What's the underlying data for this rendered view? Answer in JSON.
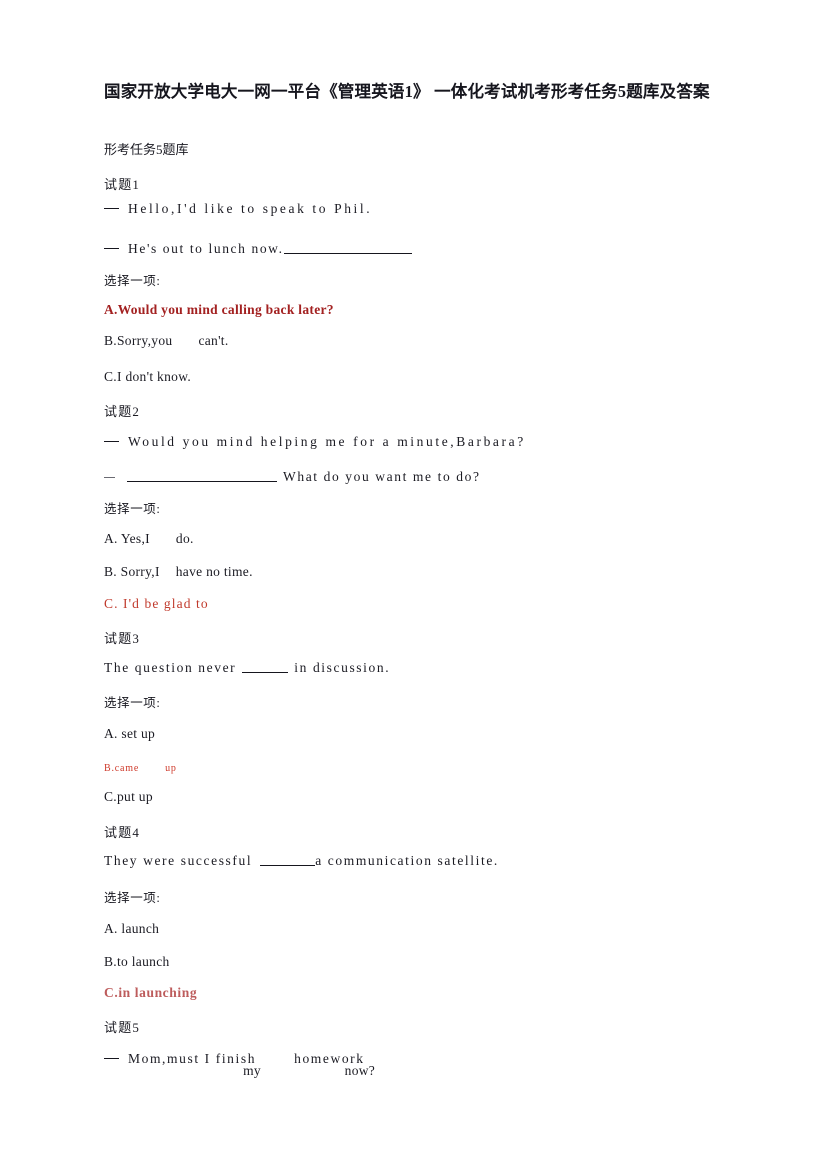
{
  "document": {
    "title": "国家开放大学电大一网一平台《管理英语1》 一体化考试机考形考任务5题库及答案",
    "section_label": "形考任务5题库",
    "choose_one_label": "选择一项:",
    "colors": {
      "text": "#1a1a22",
      "answer_crimson": "#a32121",
      "answer_red": "#c0392b",
      "answer_red_small": "#cf3b2c",
      "answer_rose": "#bd5c5c"
    }
  },
  "questions": [
    {
      "heading": "试题1",
      "prompt_lines": [
        "Hello,I'd  like  to  speak  to  Phil.",
        "He's  out  to  lunch  now."
      ],
      "choose_label": "选择一项:",
      "options": [
        {
          "label": "A.Would you mind calling back later?",
          "is_answer": true,
          "style": "bold-crimson"
        },
        {
          "label": "B.Sorry,you",
          "label_tail": "can't.",
          "is_answer": false,
          "style": "normal"
        },
        {
          "label": "C.I  don't  know.",
          "is_answer": false,
          "style": "normal"
        }
      ]
    },
    {
      "heading": "试题2",
      "prompt_lines": [
        "Would  you  mind  helping  me  for  a  minute,Barbara?",
        "What do you want me to do?"
      ],
      "choose_label": "选择一项:",
      "options": [
        {
          "label": "A. Yes,I",
          "label_tail": "do.",
          "is_answer": false,
          "style": "normal"
        },
        {
          "label": "B. Sorry,I",
          "label_tail": "have   no   time.",
          "is_answer": false,
          "style": "normal"
        },
        {
          "label": "C. I'd  be  glad  to",
          "is_answer": true,
          "style": "red"
        }
      ]
    },
    {
      "heading": "试题3",
      "sentence_before": "The  question  never",
      "sentence_after": "in   discussion.",
      "choose_label": "选择一项:",
      "options": [
        {
          "label": "A.  set  up",
          "is_answer": false,
          "style": "normal"
        },
        {
          "label": "B.came",
          "label_tail": "up",
          "is_answer": true,
          "style": "red-small"
        },
        {
          "label": "C.put  up",
          "is_answer": false,
          "style": "normal"
        }
      ]
    },
    {
      "heading": "试题4",
      "sentence_before": "They  were  successful",
      "sentence_after": "a   communication   satellite.",
      "choose_label": "选择一项:",
      "options": [
        {
          "label": "A. launch",
          "is_answer": false,
          "style": "normal"
        },
        {
          "label": "B.to  launch",
          "is_answer": false,
          "style": "normal"
        },
        {
          "label": "C.in  launching",
          "is_answer": true,
          "style": "bold-rose"
        }
      ]
    },
    {
      "heading": "试题5",
      "prompt_line_parts": {
        "part1": "Mom,must  I  finish",
        "part2": "my",
        "part3": "homework",
        "part4": "now?"
      }
    }
  ]
}
